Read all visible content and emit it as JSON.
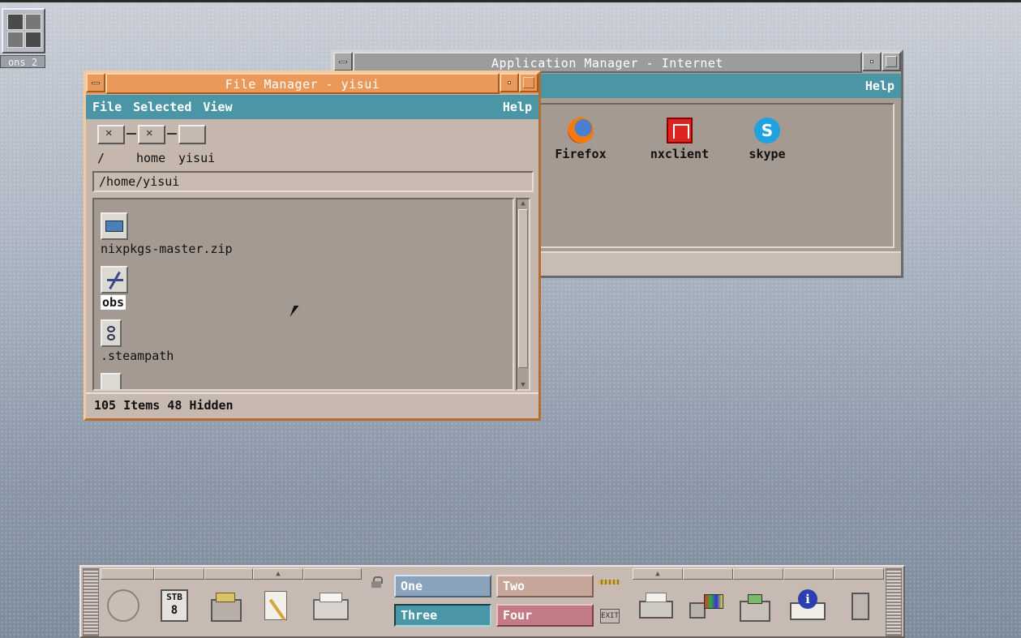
{
  "desktop": {
    "icon_label": "ons 2"
  },
  "app_manager": {
    "title": "Application Manager - Internet",
    "menu": {
      "help": "Help"
    },
    "apps": [
      {
        "label": "Firefox",
        "icon": "firefox-icon"
      },
      {
        "label": "nxclient",
        "icon": "nxclient-icon"
      },
      {
        "label": "skype",
        "icon": "skype-icon"
      }
    ]
  },
  "file_manager": {
    "title": "File Manager - yisui",
    "menu": {
      "file": "File",
      "selected": "Selected",
      "view": "View",
      "help": "Help"
    },
    "iconic_path": {
      "root": "/",
      "home": "home",
      "user": "yisui"
    },
    "path": "/home/yisui",
    "files": [
      {
        "name": "nixpkgs-master.zip",
        "icon": "archive-icon",
        "selected": false
      },
      {
        "name": "obs",
        "icon": "executable-icon",
        "selected": true
      },
      {
        "name": ".steampath",
        "icon": "link-icon",
        "selected": false
      }
    ],
    "status": "105 Items 48 Hidden"
  },
  "front_panel": {
    "date_day": "8",
    "date_month": "STB",
    "exit_label": "EXIT",
    "workspaces": {
      "one": "One",
      "two": "Two",
      "three": "Three",
      "four": "Four"
    },
    "active_workspace": "Three"
  },
  "colors": {
    "active_title": "#e89a5c",
    "inactive_title": "#a7a7a7",
    "menubar": "#4a96a7",
    "window_bg": "#c5b7ae"
  }
}
